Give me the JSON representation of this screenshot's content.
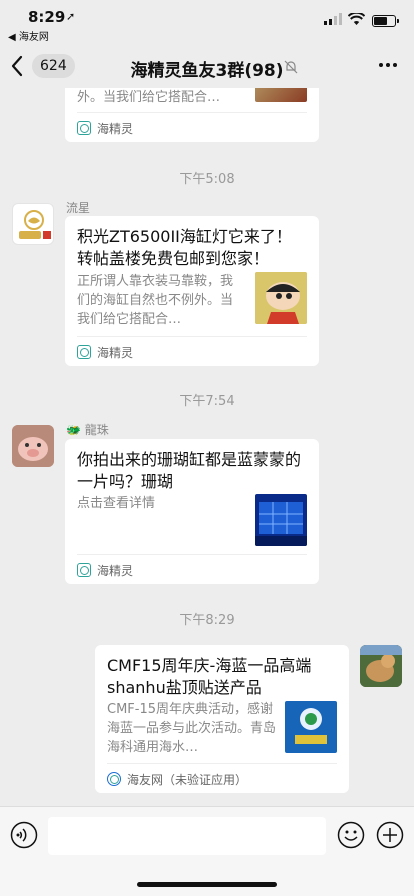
{
  "status_bar": {
    "time": "8:29",
    "back_app": "◀ 海友网"
  },
  "nav": {
    "unread_count": "624",
    "title": "海精灵鱼友3群(98)"
  },
  "timestamps": [
    "下午5:08",
    "下午7:54",
    "下午8:29"
  ],
  "messages": [
    {
      "partial": true,
      "desc_tail": "外。当我们给它搭配合…",
      "source": "海精灵"
    },
    {
      "sender": "流星",
      "title": "积光ZT6500II海缸灯它来了！转帖盖楼免费包邮到您家！",
      "desc": "正所谓人靠衣装马靠鞍，我们的海缸自然也不例外。当我们给它搭配合…",
      "source": "海精灵"
    },
    {
      "sender": "🐲 龍珠",
      "title": "你拍出来的珊瑚缸都是蓝蒙蒙的一片吗？珊瑚",
      "desc": "点击查看详情",
      "source": "海精灵"
    },
    {
      "self": true,
      "title": "CMF15周年庆-海蓝一品高端shanhu盐顶贴送产品",
      "desc": "CMF-15周年庆典活动，感谢海蓝一品参与此次活动。青岛海科通用海水…",
      "source": "海友网（未验证应用）"
    }
  ],
  "colors": {
    "background": "#ededed",
    "card": "#ffffff",
    "source_icon": "#2ea39a"
  }
}
